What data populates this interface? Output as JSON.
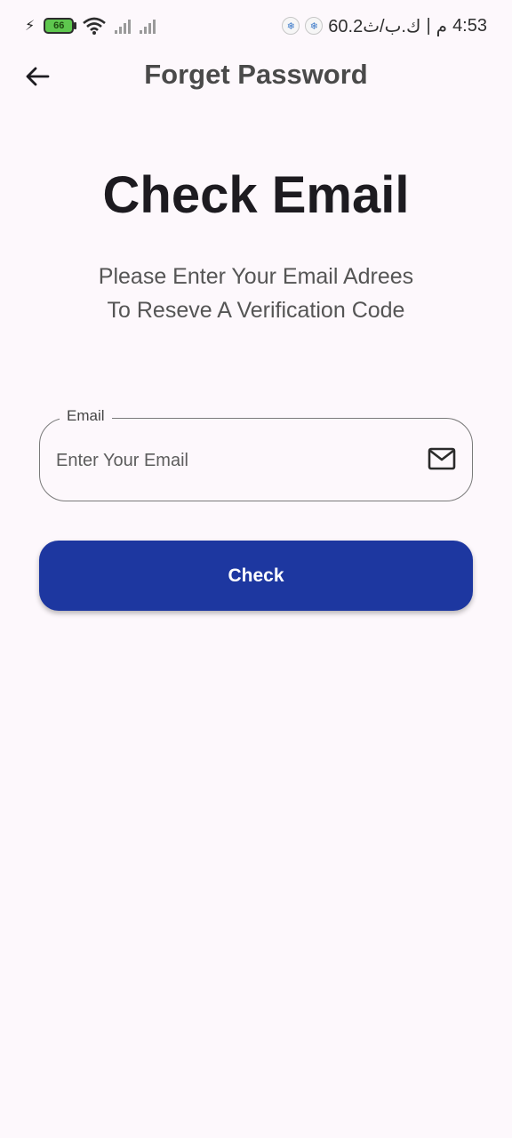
{
  "status_bar": {
    "battery_level": "66",
    "time": "4:53",
    "meridiem": "م",
    "separator": "|",
    "network_speed": "60.2ك.ب/ث"
  },
  "appbar": {
    "title": "Forget Password",
    "back_icon": "arrow-left-icon"
  },
  "main": {
    "title": "Check Email",
    "subtitle_line1": "Please Enter Your Email Adrees",
    "subtitle_line2": "To Reseve A Verification Code"
  },
  "email_field": {
    "label": "Email",
    "placeholder": "Enter Your Email",
    "value": "",
    "icon": "mail-icon"
  },
  "check_button": {
    "label": "Check",
    "color": "#1d37a0"
  }
}
